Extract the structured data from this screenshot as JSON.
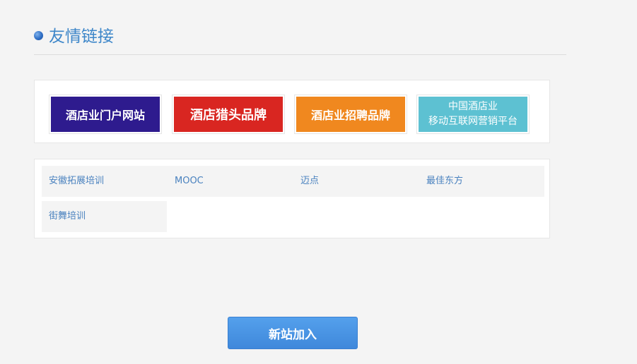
{
  "section": {
    "title": "友情链接"
  },
  "logo_links": [
    {
      "lines": [
        "酒店业门户网站"
      ],
      "bg": "#2e1b8e",
      "font_size": "16px"
    },
    {
      "lines": [
        "酒店猎头品牌"
      ],
      "bg": "#d92621",
      "font_size": "18px"
    },
    {
      "lines": [
        "酒店业招聘品牌"
      ],
      "bg": "#f0881f",
      "font_size": "16px"
    },
    {
      "lines": [
        "中国酒店业",
        "移动互联网营销平台"
      ],
      "bg": "#5dc1d2",
      "font_size": "14px"
    }
  ],
  "text_links": {
    "row1": [
      "安徽拓展培训",
      "MOOC",
      "迈点",
      "最佳东方"
    ],
    "row2": [
      "街舞培训"
    ]
  },
  "buttons": {
    "new_site": "新站加入"
  },
  "colors": {
    "accent": "#3d86c9",
    "link": "#4a82bf",
    "button": "#4a92e2"
  }
}
